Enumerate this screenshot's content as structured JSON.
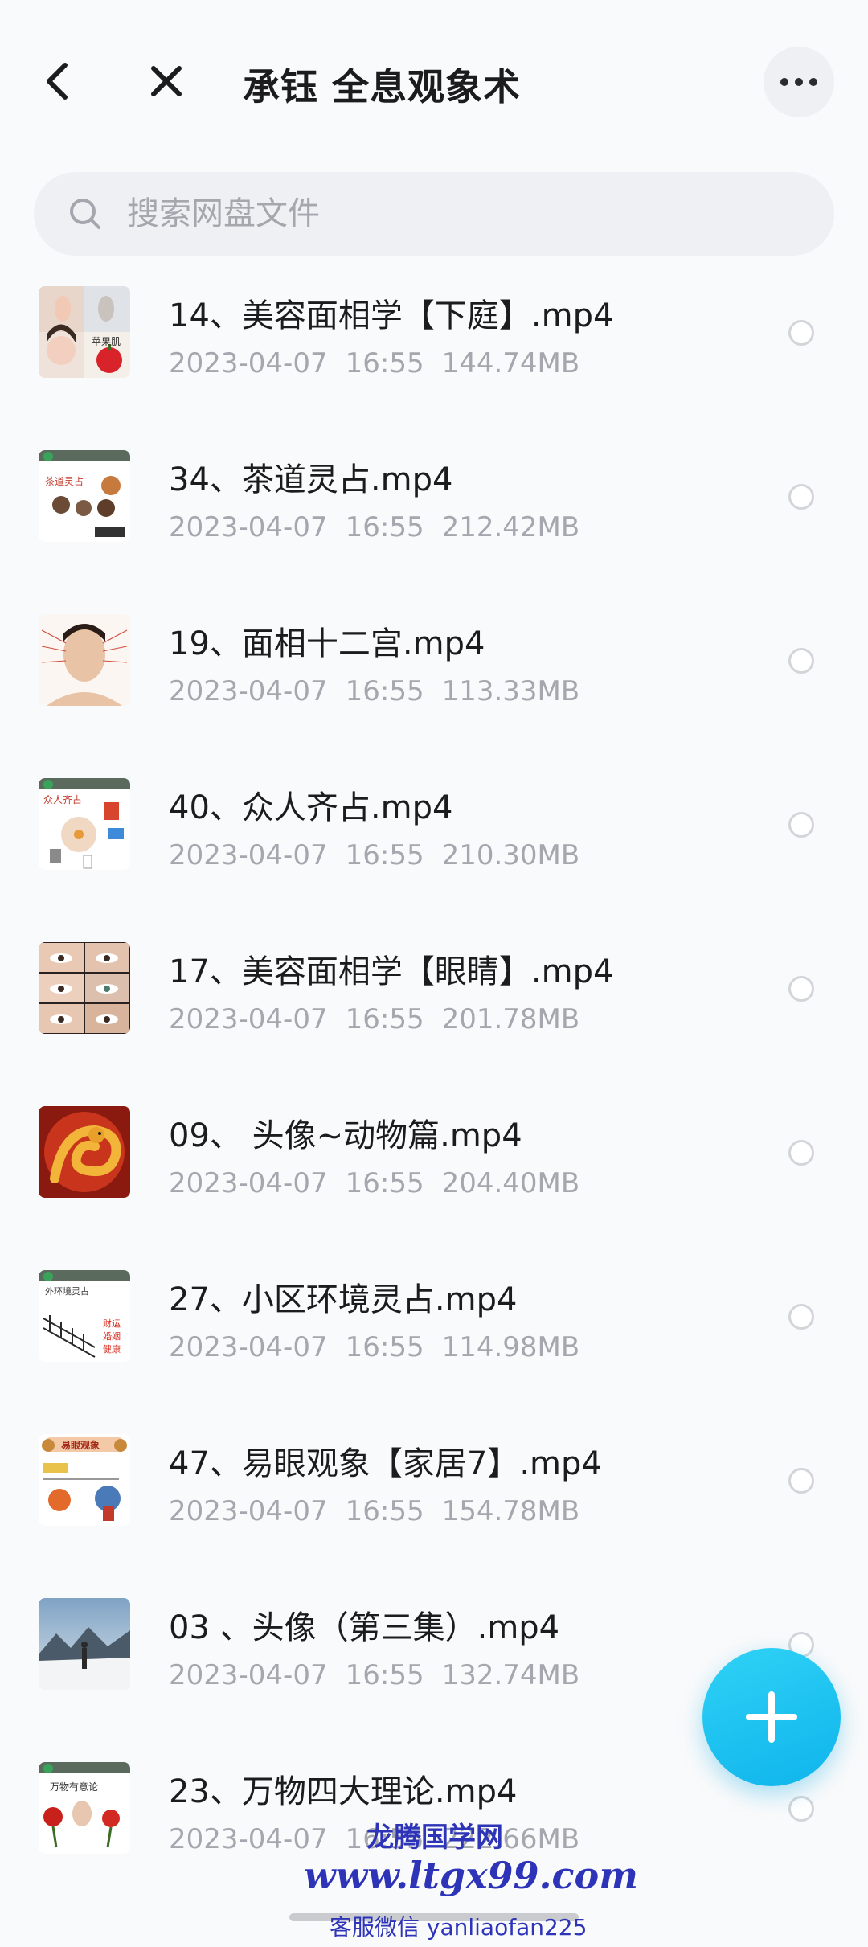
{
  "header": {
    "title": "承钰 全息观象术",
    "back_icon": "chevron-left-icon",
    "close_icon": "close-icon",
    "more_icon": "more-horizontal-icon"
  },
  "search": {
    "placeholder": "搜索网盘文件",
    "value": ""
  },
  "files": [
    {
      "name": "14、美容面相学【下庭】.mp4",
      "date": "2023-04-07",
      "time": "16:55",
      "size": "144.74MB",
      "thumb_text": "苹果肌"
    },
    {
      "name": "34、茶道灵占.mp4",
      "date": "2023-04-07",
      "time": "16:55",
      "size": "212.42MB",
      "thumb_text": "茶道灵占"
    },
    {
      "name": "19、面相十二宫.mp4",
      "date": "2023-04-07",
      "time": "16:55",
      "size": "113.33MB",
      "thumb_text": ""
    },
    {
      "name": "40、众人齐占.mp4",
      "date": "2023-04-07",
      "time": "16:55",
      "size": "210.30MB",
      "thumb_text": "众人齐占"
    },
    {
      "name": "17、美容面相学【眼睛】.mp4",
      "date": "2023-04-07",
      "time": "16:55",
      "size": "201.78MB",
      "thumb_text": ""
    },
    {
      "name": "09、 头像~动物篇.mp4",
      "date": "2023-04-07",
      "time": "16:55",
      "size": "204.40MB",
      "thumb_text": ""
    },
    {
      "name": "27、小区环境灵占.mp4",
      "date": "2023-04-07",
      "time": "16:55",
      "size": "114.98MB",
      "thumb_text": "外环境灵占"
    },
    {
      "name": "47、易眼观象【家居7】.mp4",
      "date": "2023-04-07",
      "time": "16:55",
      "size": "154.78MB",
      "thumb_text": "易眼观象"
    },
    {
      "name": "03 、头像（第三集）.mp4",
      "date": "2023-04-07",
      "time": "16:55",
      "size": "132.74MB",
      "thumb_text": ""
    },
    {
      "name": "23、万物四大理论.mp4",
      "date": "2023-04-07",
      "time": "16:55",
      "size": "222.66MB",
      "thumb_text": "万物有意论"
    }
  ],
  "fab": {
    "icon": "plus-icon"
  },
  "watermark": {
    "line1": "龙腾国学网",
    "line2": "www.ltgx99.com",
    "line3": "客服微信 yanliaofan225"
  },
  "colors": {
    "accent": "#17bdf0",
    "title": "#1c1c1e",
    "meta": "#a4a7ae",
    "watermark": "#2d34b8"
  }
}
